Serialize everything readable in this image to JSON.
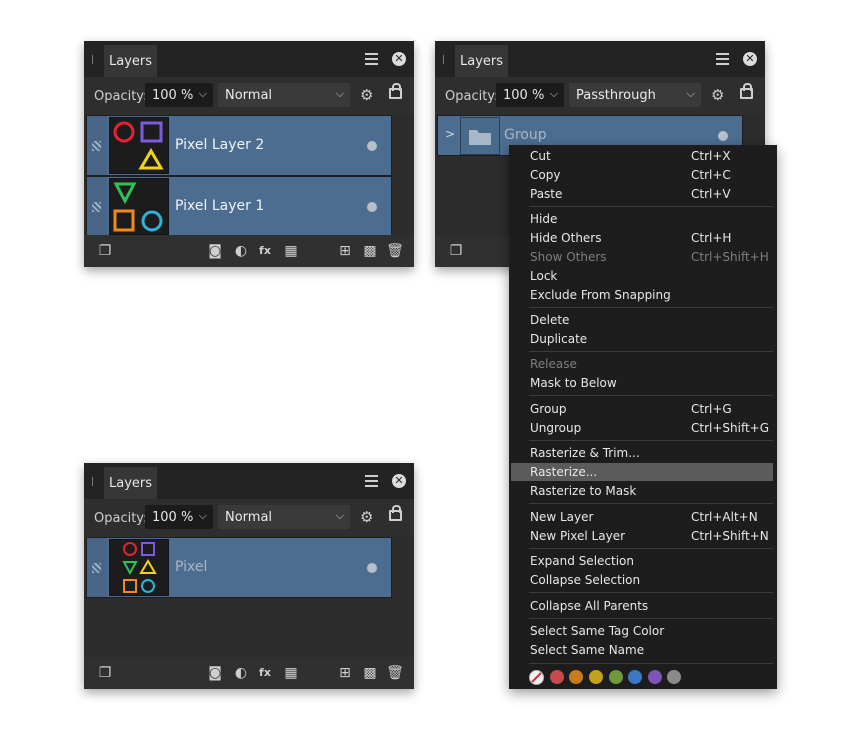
{
  "panel1": {
    "tab": "Layers",
    "opacity_label": "Opacity:",
    "opacity_value": "100 %",
    "blend_mode": "Normal",
    "layers": [
      {
        "name": "Pixel Layer 2"
      },
      {
        "name": "Pixel Layer 1"
      }
    ]
  },
  "panel2": {
    "tab": "Layers",
    "opacity_label": "Opacity:",
    "opacity_value": "100 %",
    "blend_mode": "Passthrough",
    "group_name": "Group",
    "expand_glyph": ">"
  },
  "panel3": {
    "tab": "Layers",
    "opacity_label": "Opacity:",
    "opacity_value": "100 %",
    "blend_mode": "Normal",
    "layer_name": "Pixel"
  },
  "context_menu": {
    "items": [
      {
        "label": "Cut",
        "shortcut": "Ctrl+X",
        "enabled": true
      },
      {
        "label": "Copy",
        "shortcut": "Ctrl+C",
        "enabled": true
      },
      {
        "label": "Paste",
        "shortcut": "Ctrl+V",
        "enabled": true
      },
      {
        "label": "Hide",
        "shortcut": "",
        "enabled": true
      },
      {
        "label": "Hide Others",
        "shortcut": "Ctrl+H",
        "enabled": true
      },
      {
        "label": "Show Others",
        "shortcut": "Ctrl+Shift+H",
        "enabled": false
      },
      {
        "label": "Lock",
        "shortcut": "",
        "enabled": true
      },
      {
        "label": "Exclude From Snapping",
        "shortcut": "",
        "enabled": true
      },
      {
        "label": "Delete",
        "shortcut": "",
        "enabled": true
      },
      {
        "label": "Duplicate",
        "shortcut": "",
        "enabled": true
      },
      {
        "label": "Release",
        "shortcut": "",
        "enabled": false
      },
      {
        "label": "Mask to Below",
        "shortcut": "",
        "enabled": true
      },
      {
        "label": "Group",
        "shortcut": "Ctrl+G",
        "enabled": true
      },
      {
        "label": "Ungroup",
        "shortcut": "Ctrl+Shift+G",
        "enabled": true
      },
      {
        "label": "Rasterize & Trim...",
        "shortcut": "",
        "enabled": true
      },
      {
        "label": "Rasterize...",
        "shortcut": "",
        "enabled": true,
        "highlighted": true
      },
      {
        "label": "Rasterize to Mask",
        "shortcut": "",
        "enabled": true
      },
      {
        "label": "New Layer",
        "shortcut": "Ctrl+Alt+N",
        "enabled": true
      },
      {
        "label": "New Pixel Layer",
        "shortcut": "Ctrl+Shift+N",
        "enabled": true
      },
      {
        "label": "Expand Selection",
        "shortcut": "",
        "enabled": true
      },
      {
        "label": "Collapse Selection",
        "shortcut": "",
        "enabled": true
      },
      {
        "label": "Collapse All Parents",
        "shortcut": "",
        "enabled": true
      },
      {
        "label": "Select Same Tag Color",
        "shortcut": "",
        "enabled": true
      },
      {
        "label": "Select Same Name",
        "shortcut": "",
        "enabled": true
      }
    ],
    "tag_colors": [
      "none",
      "#c94a4a",
      "#c77a1e",
      "#c2a21b",
      "#6d9a3a",
      "#3f78c2",
      "#7b55b8",
      "#8a8a8a"
    ]
  },
  "shape_colors": {
    "red": "#e32236",
    "purple": "#7d5be0",
    "yellow": "#f2d21a",
    "green": "#2fc25a",
    "orange": "#f08a1c",
    "cyan": "#2fb2d8"
  }
}
